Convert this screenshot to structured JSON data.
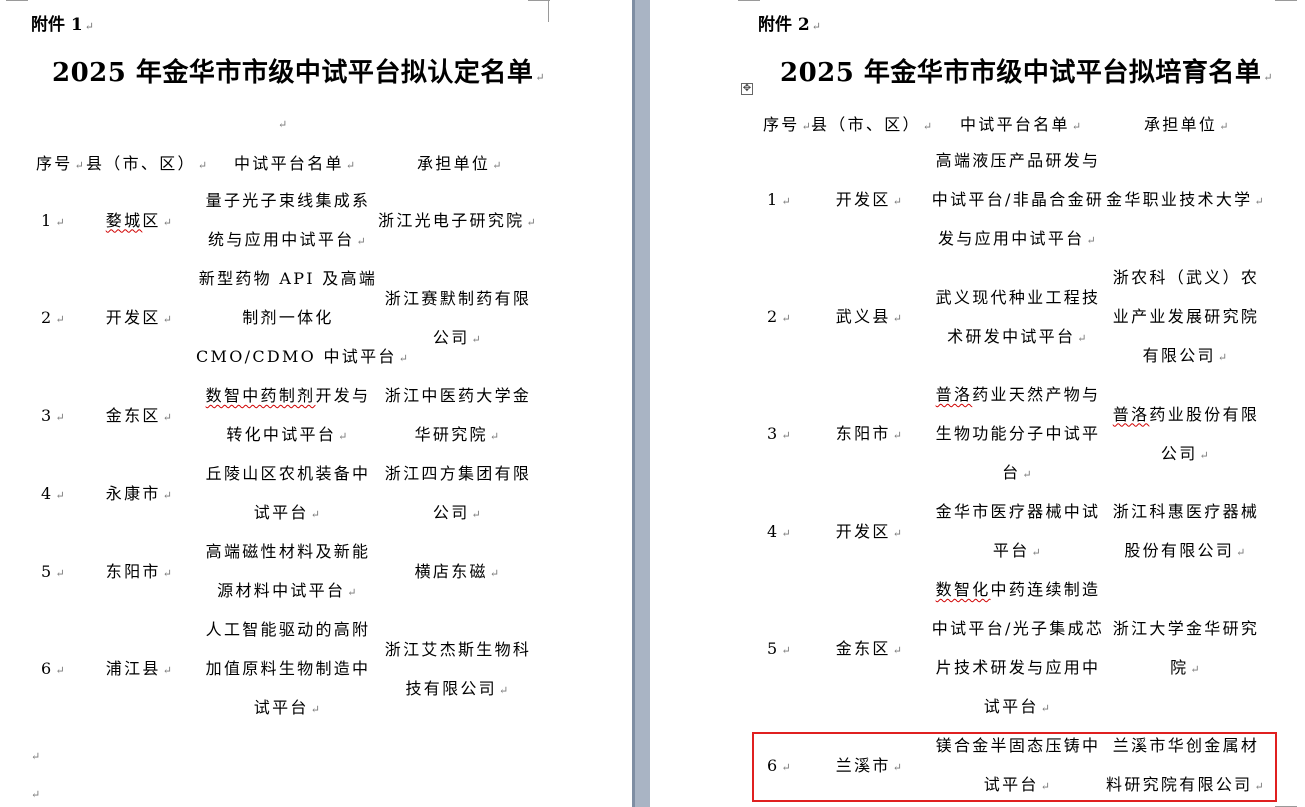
{
  "left_doc": {
    "attachment": "附件 1",
    "title": "2025 年金华市市级中试平台拟认定名单",
    "headers": {
      "no": "序号",
      "county": "县（市、区）",
      "platform": "中试平台名单",
      "unit": "承担单位"
    },
    "rows": [
      {
        "no": "1",
        "county": "婺城区",
        "platform_lines": [
          "量子光子束线集成系",
          "统与应用中试平台"
        ],
        "unit_lines": [
          "浙江光电子研究院"
        ]
      },
      {
        "no": "2",
        "county": "开发区",
        "platform_lines": [
          "新型药物 API 及高端",
          "制剂一体化",
          "CMO/CDMO 中试平台"
        ],
        "unit_lines": [
          "浙江赛默制药有限",
          "公司"
        ]
      },
      {
        "no": "3",
        "county": "金东区",
        "platform_lines": [
          "数智中药制剂开发与",
          "转化中试平台"
        ],
        "unit_lines": [
          "浙江中医药大学金",
          "华研究院"
        ]
      },
      {
        "no": "4",
        "county": "永康市",
        "platform_lines": [
          "丘陵山区农机装备中",
          "试平台"
        ],
        "unit_lines": [
          "浙江四方集团有限",
          "公司"
        ]
      },
      {
        "no": "5",
        "county": "东阳市",
        "platform_lines": [
          "高端磁性材料及新能",
          "源材料中试平台"
        ],
        "unit_lines": [
          "横店东磁"
        ]
      },
      {
        "no": "6",
        "county": "浦江县",
        "platform_lines": [
          "人工智能驱动的高附",
          "加值原料生物制造中",
          "试平台"
        ],
        "unit_lines": [
          "浙江艾杰斯生物科",
          "技有限公司"
        ]
      }
    ]
  },
  "right_doc": {
    "attachment": "附件 2",
    "title": "2025 年金华市市级中试平台拟培育名单",
    "headers": {
      "no": "序号",
      "county": "县（市、区）",
      "platform": "中试平台名单",
      "unit": "承担单位"
    },
    "rows": [
      {
        "no": "1",
        "county": "开发区",
        "platform_lines": [
          "高端液压产品研发与",
          "中试平台/非晶合金研",
          "发与应用中试平台"
        ],
        "unit_lines": [
          "金华职业技术大学"
        ]
      },
      {
        "no": "2",
        "county": "武义县",
        "platform_lines": [
          "武义现代种业工程技",
          "术研发中试平台"
        ],
        "unit_lines": [
          "浙农科（武义）农",
          "业产业发展研究院",
          "有限公司"
        ]
      },
      {
        "no": "3",
        "county": "东阳市",
        "platform_lines": [
          "普洛药业天然产物与",
          "生物功能分子中试平",
          "台"
        ],
        "unit_lines": [
          "普洛药业股份有限",
          "公司"
        ]
      },
      {
        "no": "4",
        "county": "开发区",
        "platform_lines": [
          "金华市医疗器械中试",
          "平台"
        ],
        "unit_lines": [
          "浙江科惠医疗器械",
          "股份有限公司"
        ]
      },
      {
        "no": "5",
        "county": "金东区",
        "platform_lines": [
          "数智化中药连续制造",
          "中试平台/光子集成芯",
          "片技术研发与应用中",
          "试平台"
        ],
        "unit_lines": [
          "浙江大学金华研究",
          "院"
        ]
      },
      {
        "no": "6",
        "county": "兰溪市",
        "platform_lines": [
          "镁合金半固态压铸中",
          "试平台"
        ],
        "unit_lines": [
          "兰溪市华创金属材",
          "料研究院有限公司"
        ]
      }
    ]
  },
  "marks": {
    "para": "↵",
    "move": "✥"
  },
  "colors": {
    "highlight": "#e02020",
    "gutter": "#a9b4c4",
    "spell": "#d00000"
  }
}
